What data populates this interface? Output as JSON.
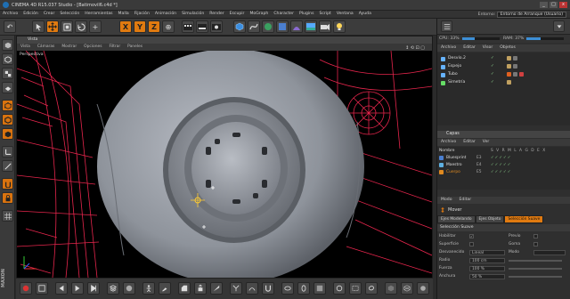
{
  "titlebar": {
    "title": "CINEMA 4D R15.037 Studio - [Batimovil6.c4d *]",
    "min": "_",
    "max": "□",
    "close": "x"
  },
  "menubar": {
    "items": [
      "Archivo",
      "Edición",
      "Crear",
      "Selección",
      "Herramientas",
      "Malla",
      "Fijación",
      "Animación",
      "Simulación",
      "Render",
      "Escupir",
      "MoGraph",
      "Character",
      "Plugins",
      "Script",
      "Ventana",
      "Ayuda"
    ],
    "layout_label": "Entorno:",
    "layout_value": "Entorno de Arranque (Usuario)"
  },
  "toolbar": {
    "undo_icon": "↶",
    "axis_x": "X",
    "axis_y": "Y",
    "axis_z": "Z",
    "world_icon": "⊕"
  },
  "viewport": {
    "window_title": "Vista",
    "menu": [
      "Vista",
      "Cámaras",
      "Mostrar",
      "Opciones",
      "Filtrar",
      "Paneles"
    ],
    "label": "Perspectiva",
    "nav_icons": "↕ ⟲ ⊡ ▢"
  },
  "stats": {
    "cpu_label": "CPU: 33%",
    "cpu_value": 33,
    "ram_label": "RAM: 37%",
    "ram_value": 37
  },
  "objects_panel": {
    "tabs": [
      "Archivo",
      "Editar",
      "Visor",
      "Objetos"
    ],
    "rows": [
      {
        "name": "Desvío.2",
        "icon_color": "#66b3ff",
        "flags": "✓",
        "tags": [
          "#c0a060",
          "#777"
        ]
      },
      {
        "name": "Espejo",
        "icon_color": "#66b3ff",
        "flags": "✓",
        "tags": [
          "#c0a060",
          "#777"
        ]
      },
      {
        "name": "Tubo",
        "icon_color": "#66b3ff",
        "flags": "✓",
        "tags": [
          "#e06020",
          "#777",
          "#d04040"
        ]
      },
      {
        "name": "Simetría",
        "icon_color": "#66dd66",
        "flags": "✓",
        "tags": [
          "#c0a060"
        ]
      }
    ]
  },
  "layers_panel": {
    "header": "Capas",
    "tabs": [
      "Archivo",
      "Editar",
      "Ver"
    ],
    "columns": {
      "name": "Nombre",
      "icons": "S V R M L A G D E X"
    },
    "rows": [
      {
        "name": "Bluesprint",
        "count": "E3",
        "color": "#4a7fd0",
        "icons": "✓✓✓✓✓"
      },
      {
        "name": "Maestro",
        "count": "E4",
        "color": "#5fb0e0",
        "icons": "✓✓✓✓✓"
      },
      {
        "name": "Cuerpo",
        "count": "E5",
        "color": "#e08a20",
        "icons": "✓✓✓✓✓"
      }
    ]
  },
  "attributes_panel": {
    "tabs": [
      "Modo",
      "Editar"
    ],
    "tool_name": "Mover",
    "subtabs": [
      "Ejes Modelando",
      "Ejes Objeto",
      "Selección Suave"
    ],
    "active_subtab": "Selección Suave",
    "section": "Selección Suave",
    "fields": [
      {
        "label": "Habilitar",
        "type": "check",
        "value": "✓",
        "label2": "Previo",
        "type2": "check"
      },
      {
        "label": "Superficie",
        "type": "check",
        "value": "",
        "label2": "Goma",
        "type2": "check"
      },
      {
        "label": "Desvanecido",
        "type": "field",
        "value": "Lineal",
        "label2": "Modo",
        "type2": "field"
      },
      {
        "label": "Radio",
        "type": "field",
        "value": "100 cm",
        "label2": "",
        "type2": "slider"
      },
      {
        "label": "Fuerza",
        "type": "field",
        "value": "100 %",
        "label2": "",
        "type2": "slider"
      },
      {
        "label": "Anchura",
        "type": "field",
        "value": "50 %",
        "label2": "",
        "type2": "slider"
      }
    ]
  },
  "colors": {
    "accent": "#e07a10",
    "wireframe": "#ff2a55",
    "background": "#000000"
  }
}
